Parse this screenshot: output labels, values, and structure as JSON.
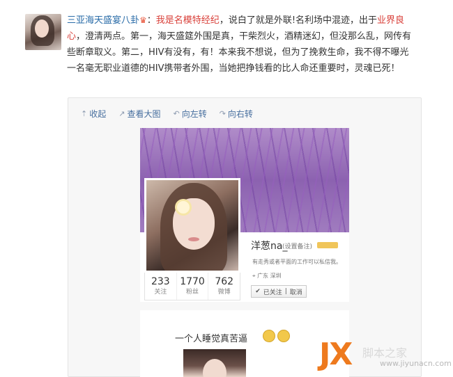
{
  "post": {
    "author": "三亚海天盛宴八卦",
    "author_badge_icon": "crown-icon",
    "colon": "：",
    "highlight1": "我是名模特经纪",
    "text1": "，说白了就是外联!名利场中混迹，出于",
    "highlight2": "业界良心",
    "text2": "，澄清两点。第一，海天盛筵外围是真，干柴烈火，酒精迷幻，但没那么乱，网传有些断章取义。第二，HIV有没有，有！本来我不想说，但为了挽救生命，我不得不曝光一名毫无职业道德的HIV携带者外围，当她把挣钱看的比人命还重要时，灵魂已死！"
  },
  "toolbar": {
    "collapse": "收起",
    "view_large": "查看大图",
    "rotate_left": "向左转",
    "rotate_right": "向右转"
  },
  "profile": {
    "username": "洋葱na_",
    "note": "(设置备注)",
    "bio": "有走秀或者平面的工作可以私信我。",
    "location": "广东 深圳",
    "follow_label": "已关注",
    "unfollow_label": "取消",
    "stats": [
      {
        "count": "233",
        "label": "关注"
      },
      {
        "count": "1770",
        "label": "粉丝"
      },
      {
        "count": "762",
        "label": "微博"
      }
    ]
  },
  "second_image": {
    "caption": "一个人睡觉真苦逼"
  },
  "watermark": {
    "logo": "JX",
    "cn": "脚本之家",
    "site": "www.jiyunacn.com"
  },
  "colors": {
    "link": "#2a6ca8",
    "highlight": "#d9403a",
    "watermark": "#ee7a1e"
  }
}
